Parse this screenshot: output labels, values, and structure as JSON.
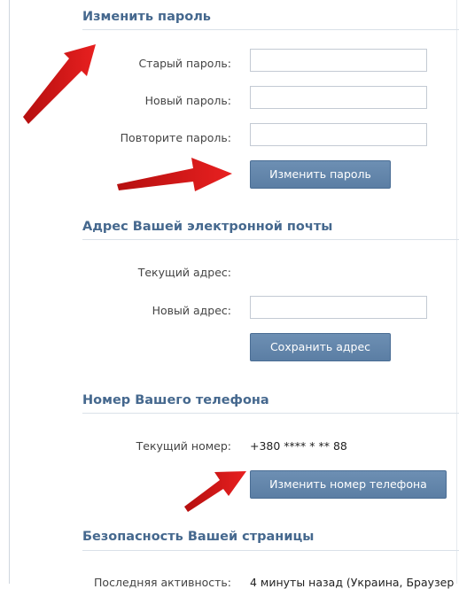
{
  "change_password": {
    "title": "Изменить пароль",
    "old_password_label": "Старый пароль:",
    "new_password_label": "Новый пароль:",
    "repeat_password_label": "Повторите пароль:",
    "old_password_value": "",
    "new_password_value": "",
    "repeat_password_value": "",
    "submit_label": "Изменить пароль"
  },
  "email": {
    "title": "Адрес Вашей электронной почты",
    "current_label": "Текущий адрес:",
    "new_label": "Новый адрес:",
    "new_value": "",
    "submit_label": "Сохранить адрес"
  },
  "phone": {
    "title": "Номер Вашего телефона",
    "current_label": "Текущий номер:",
    "current_value": "+380 **** * ** 88",
    "submit_label": "Изменить номер телефона"
  },
  "security": {
    "title": "Безопасность Вашей страницы",
    "last_activity_label": "Последняя активность:",
    "last_activity_value": "4 минуты назад (Украина, Браузер"
  },
  "colors": {
    "section_title": "#45688e",
    "button": "#5b7ea4",
    "arrow": "#e01b1b"
  }
}
